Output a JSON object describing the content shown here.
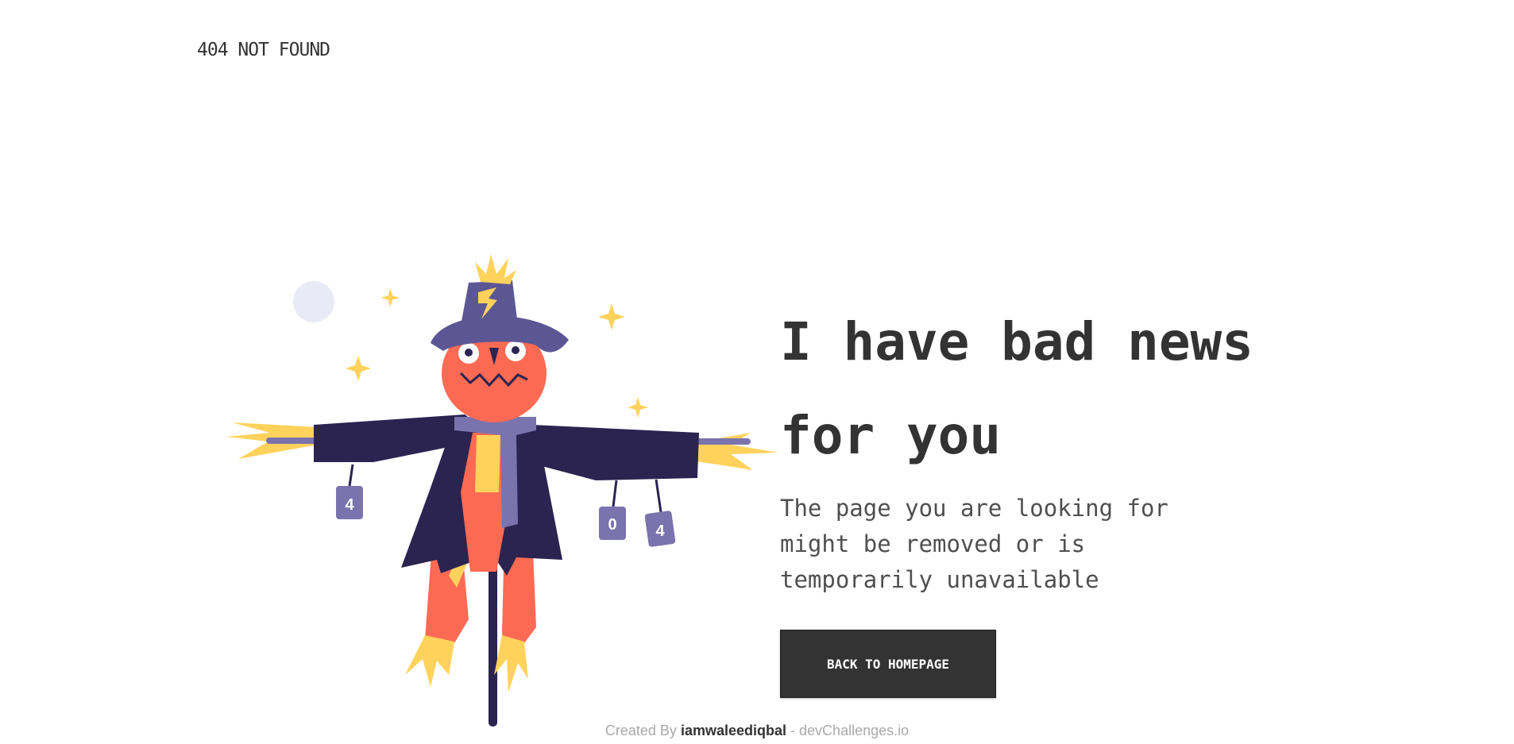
{
  "header": {
    "logo": "404 NOT FOUND"
  },
  "main": {
    "headline": "I have bad news for you",
    "subtext": "The page you are looking for might be removed or is temporarily unavailable",
    "button_label": "BACK TO HOMEPAGE"
  },
  "illustration": {
    "icon": "scarecrow-illustration",
    "can_labels": [
      "4",
      "0",
      "4"
    ]
  },
  "footer": {
    "created_by": "Created By",
    "author": "iamwaleediqbal",
    "separator": "-",
    "site": "devChallenges.io"
  },
  "colors": {
    "text": "#333333",
    "button_bg": "#333333",
    "button_text": "#ffffff",
    "scarecrow_coat": "#2b2350",
    "scarecrow_hat": "#5c5794",
    "scarecrow_skin": "#fd6a53",
    "straw": "#ffd25c",
    "moon": "#e8ebf5",
    "footer_muted": "#a9a9a9"
  }
}
